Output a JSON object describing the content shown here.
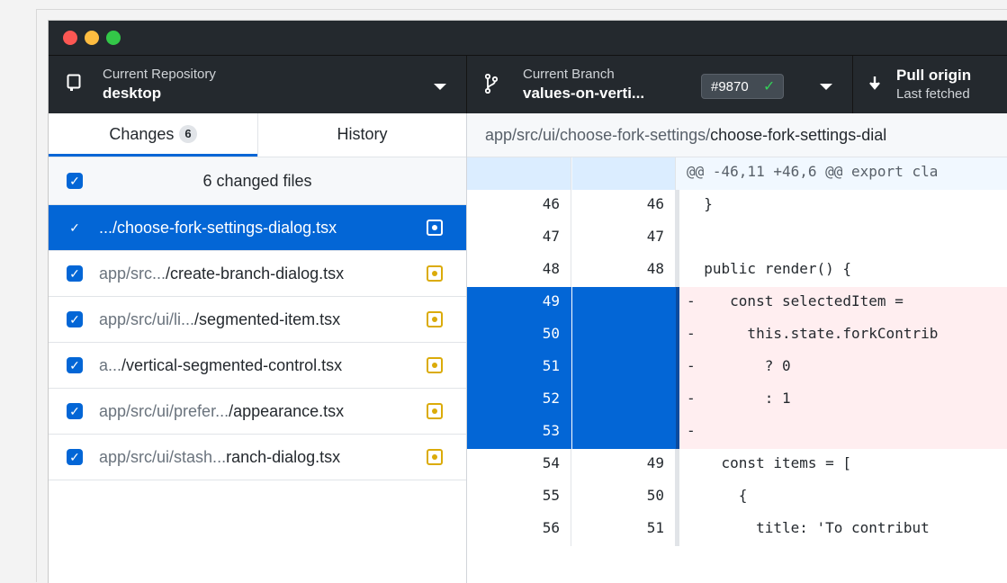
{
  "toolbar": {
    "repo": {
      "small": "Current Repository",
      "big": "desktop"
    },
    "branch": {
      "small": "Current Branch",
      "big": "values-on-verti...",
      "pr": "#9870",
      "pr_check": "✓"
    },
    "pull": {
      "big": "Pull origin",
      "small": "Last fetched"
    }
  },
  "tabs": {
    "changes": "Changes",
    "changes_count": "6",
    "history": "History"
  },
  "changes_header": "6 changed files",
  "files": [
    {
      "dim": "",
      "name": ".../choose-fork-settings-dialog.tsx"
    },
    {
      "dim": "app/src...",
      "name": "/create-branch-dialog.tsx"
    },
    {
      "dim": "app/src/ui/li...",
      "name": "/segmented-item.tsx"
    },
    {
      "dim": "a...",
      "name": "/vertical-segmented-control.tsx"
    },
    {
      "dim": "app/src/ui/prefer...",
      "name": "/appearance.tsx"
    },
    {
      "dim": "app/src/ui/stash...",
      "name": "ranch-dialog.tsx"
    }
  ],
  "file_path": {
    "dir": "app/src/ui/choose-fork-settings/",
    "file": "choose-fork-settings-dial"
  },
  "diff": [
    {
      "type": "hunk",
      "old": "",
      "new": "",
      "code": "@@ -46,11 +46,6 @@ export cla"
    },
    {
      "type": "ctx",
      "old": "46",
      "new": "46",
      "code": "  }"
    },
    {
      "type": "ctx",
      "old": "47",
      "new": "47",
      "code": ""
    },
    {
      "type": "ctx",
      "old": "48",
      "new": "48",
      "code": "  public render() {"
    },
    {
      "type": "del",
      "old": "49",
      "new": "",
      "code": "-    const selectedItem ="
    },
    {
      "type": "del",
      "old": "50",
      "new": "",
      "code": "-      this.state.forkContrib"
    },
    {
      "type": "del",
      "old": "51",
      "new": "",
      "code": "-        ? 0"
    },
    {
      "type": "del",
      "old": "52",
      "new": "",
      "code": "-        : 1"
    },
    {
      "type": "del",
      "old": "53",
      "new": "",
      "code": "-"
    },
    {
      "type": "ctx",
      "old": "54",
      "new": "49",
      "code": "    const items = ["
    },
    {
      "type": "ctx",
      "old": "55",
      "new": "50",
      "code": "      {"
    },
    {
      "type": "ctx",
      "old": "56",
      "new": "51",
      "code": "        title: 'To contribut"
    }
  ]
}
